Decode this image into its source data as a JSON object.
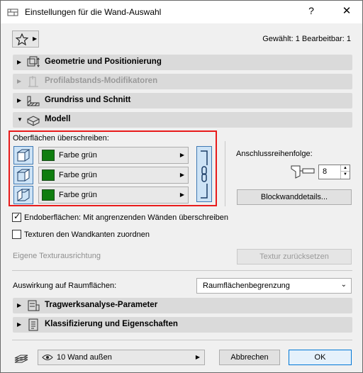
{
  "window": {
    "title": "Einstellungen für die Wand-Auswahl",
    "help_label": "?",
    "close_label": "✕"
  },
  "header": {
    "selection_info": "Gewählt: 1 Bearbeitbar: 1"
  },
  "sections": [
    {
      "label": "Geometrie und Positionierung",
      "expanded": false,
      "enabled": true,
      "icon": "geometry-icon"
    },
    {
      "label": "Profilabstands-Modifikatoren",
      "expanded": false,
      "enabled": false,
      "icon": "profile-offset-icon"
    },
    {
      "label": "Grundriss und Schnitt",
      "expanded": false,
      "enabled": true,
      "icon": "floorplan-section-icon"
    },
    {
      "label": "Modell",
      "expanded": true,
      "enabled": true,
      "icon": "model-icon"
    },
    {
      "label": "Tragwerksanalyse-Parameter",
      "expanded": false,
      "enabled": true,
      "icon": "structural-analysis-icon"
    },
    {
      "label": "Klassifizierung und Eigenschaften",
      "expanded": false,
      "enabled": true,
      "icon": "classification-icon"
    }
  ],
  "model": {
    "override_label": "Oberflächen überschreiben:",
    "surfaces": [
      {
        "face_icon": "outside-face-icon",
        "material": "Farbe grün",
        "color": "#0f7d0f"
      },
      {
        "face_icon": "edge-face-icon",
        "material": "Farbe grün",
        "color": "#0f7d0f"
      },
      {
        "face_icon": "inside-face-icon",
        "material": "Farbe grün",
        "color": "#0f7d0f"
      }
    ],
    "chain_icon": "chain-link-icon",
    "connection_order_label": "Anschlussreihenfolge:",
    "connection_order_value": "8",
    "block_details_button": "Blockwanddetails...",
    "end_surfaces_label": "Endoberflächen: Mit angrenzenden Wänden überschreiben",
    "end_surfaces_checked": true,
    "textures_label": "Texturen den Wandkanten zuordnen",
    "textures_checked": false,
    "own_texture_label": "Eigene Texturausrichtung",
    "reset_texture_button": "Textur zurücksetzen",
    "zone_effect_label": "Auswirkung auf Raumflächen:",
    "zone_effect_value": "Raumflächenbegrenzung"
  },
  "footer": {
    "layer_value": "10 Wand außen",
    "cancel_button": "Abbrechen",
    "ok_button": "OK"
  },
  "colors": {
    "accent": "#0078d7",
    "highlight_border": "#e81b1b",
    "material_green": "#0f7d0f"
  }
}
